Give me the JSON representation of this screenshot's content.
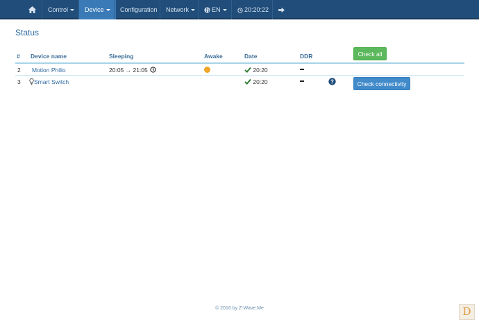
{
  "navbar": {
    "home_icon": "home-icon",
    "control": "Control",
    "device": "Device",
    "configuration": "Configuration",
    "network": "Network",
    "language": "EN",
    "language_icon": "globe-icon",
    "clock": "20:20:22",
    "clock_icon": "clock-icon",
    "logout_icon": "logout-icon"
  },
  "page": {
    "title": "Status"
  },
  "actions": {
    "check_all": "Check all"
  },
  "table": {
    "headers": {
      "num": "#",
      "device_name": "Device name",
      "sleeping": "Sleeping",
      "awake": "Awake",
      "date": "Date",
      "ddr": "DDR"
    },
    "rows": [
      {
        "num": "2",
        "name": "Motion Philio",
        "sleeping": "20:05 → 21:05",
        "sleeping_icon": "clock-icon",
        "awake": "orange-dot",
        "date": "20:20",
        "date_icon": "check-icon",
        "ddr": "–"
      },
      {
        "num": "3",
        "name": "Smart Switch",
        "name_icon": "lightbulb-icon",
        "date": "20:20",
        "date_icon": "check-icon",
        "ddr": "–",
        "help_icon": "question-icon",
        "action": "Check connectivity"
      }
    ]
  },
  "colors": {
    "navbar": "#204d7a",
    "active_tab": "#3a7ab7",
    "success": "#5cb85c",
    "primary": "#428bca",
    "awake_dot": "#f0a527",
    "check": "#2e7d32"
  },
  "footer": {
    "text": "© 2016 by Z-Wave.Me"
  },
  "corner_badge": {
    "letter": "D"
  }
}
